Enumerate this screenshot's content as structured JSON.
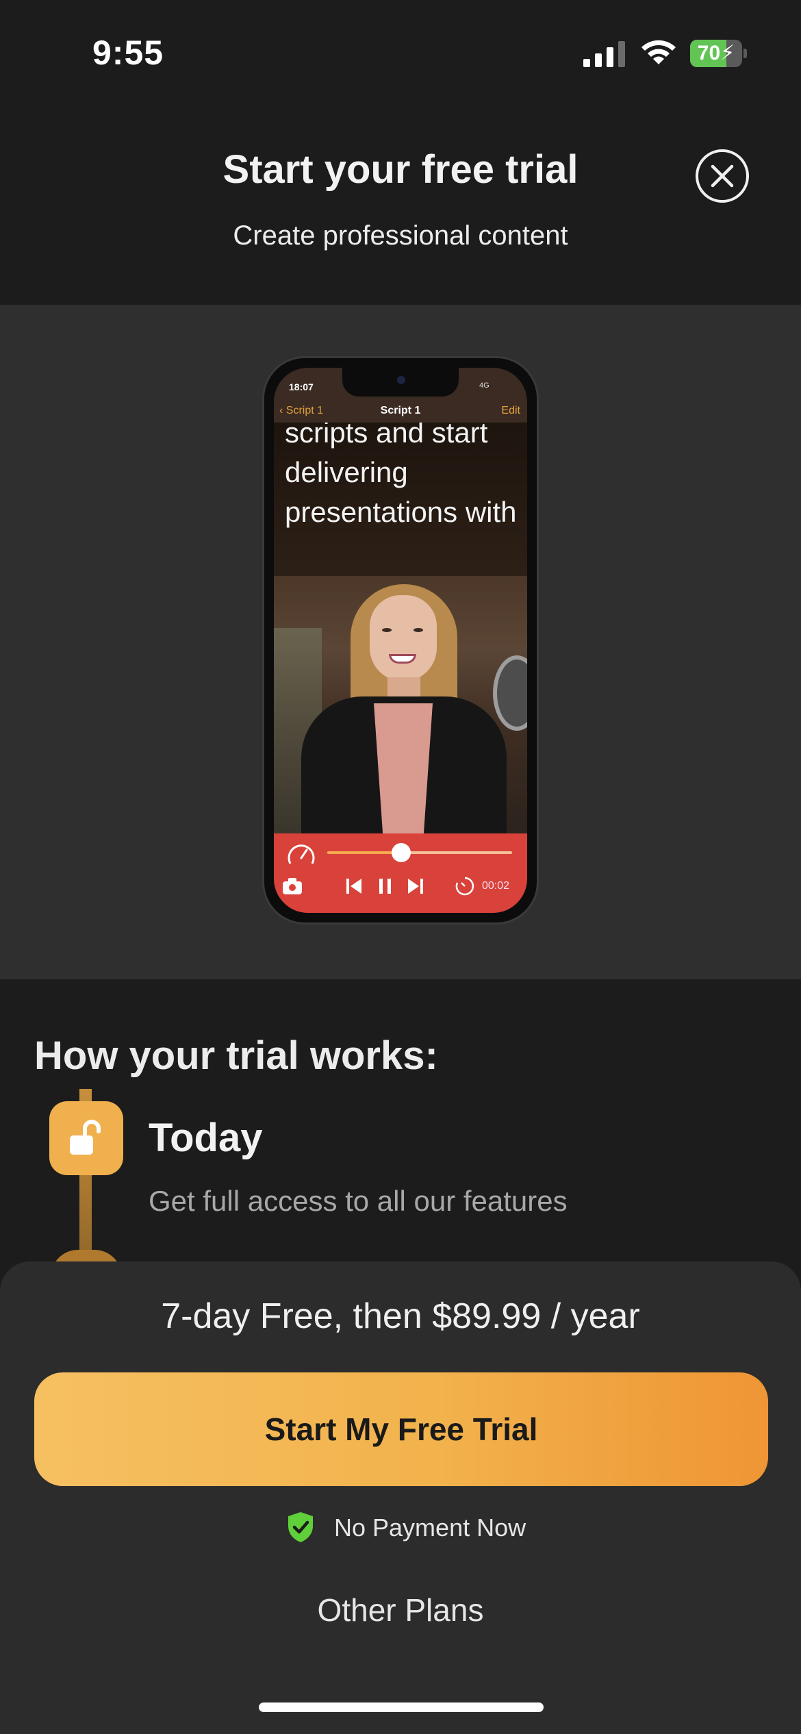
{
  "status_bar": {
    "time": "9:55",
    "battery_level": "70",
    "battery_fraction": 0.7,
    "icons": [
      "signal-icon",
      "wifi-icon",
      "battery-charging-icon"
    ]
  },
  "header": {
    "title": "Start your free trial",
    "subtitle": "Create professional content",
    "close_icon": "close-circle-icon"
  },
  "hero_phone": {
    "time": "18:07",
    "network": "4G",
    "back_label": "Script 1",
    "nav_title": "Script 1",
    "edit_label": "Edit",
    "script_text": "scripts and start delivering presentations with",
    "slider_fraction": 0.4,
    "timer": "00:02"
  },
  "trial": {
    "heading": "How your trial works:",
    "steps": [
      {
        "title": "Today",
        "description": "Get full access to all our features",
        "icon": "unlock-icon"
      }
    ]
  },
  "sheet": {
    "price": "7-day Free, then $89.99 / year",
    "cta_label": "Start My Free Trial",
    "no_payment_label": "No Payment Now",
    "other_plans_label": "Other Plans"
  },
  "colors": {
    "background": "#1c1c1c",
    "hero_background": "#2f2f2f",
    "sheet_background": "#2c2c2c",
    "accent_start": "#f6c061",
    "accent_end": "#ef9535",
    "shield_green": "#5fd03a",
    "player_red": "#d9423a"
  }
}
